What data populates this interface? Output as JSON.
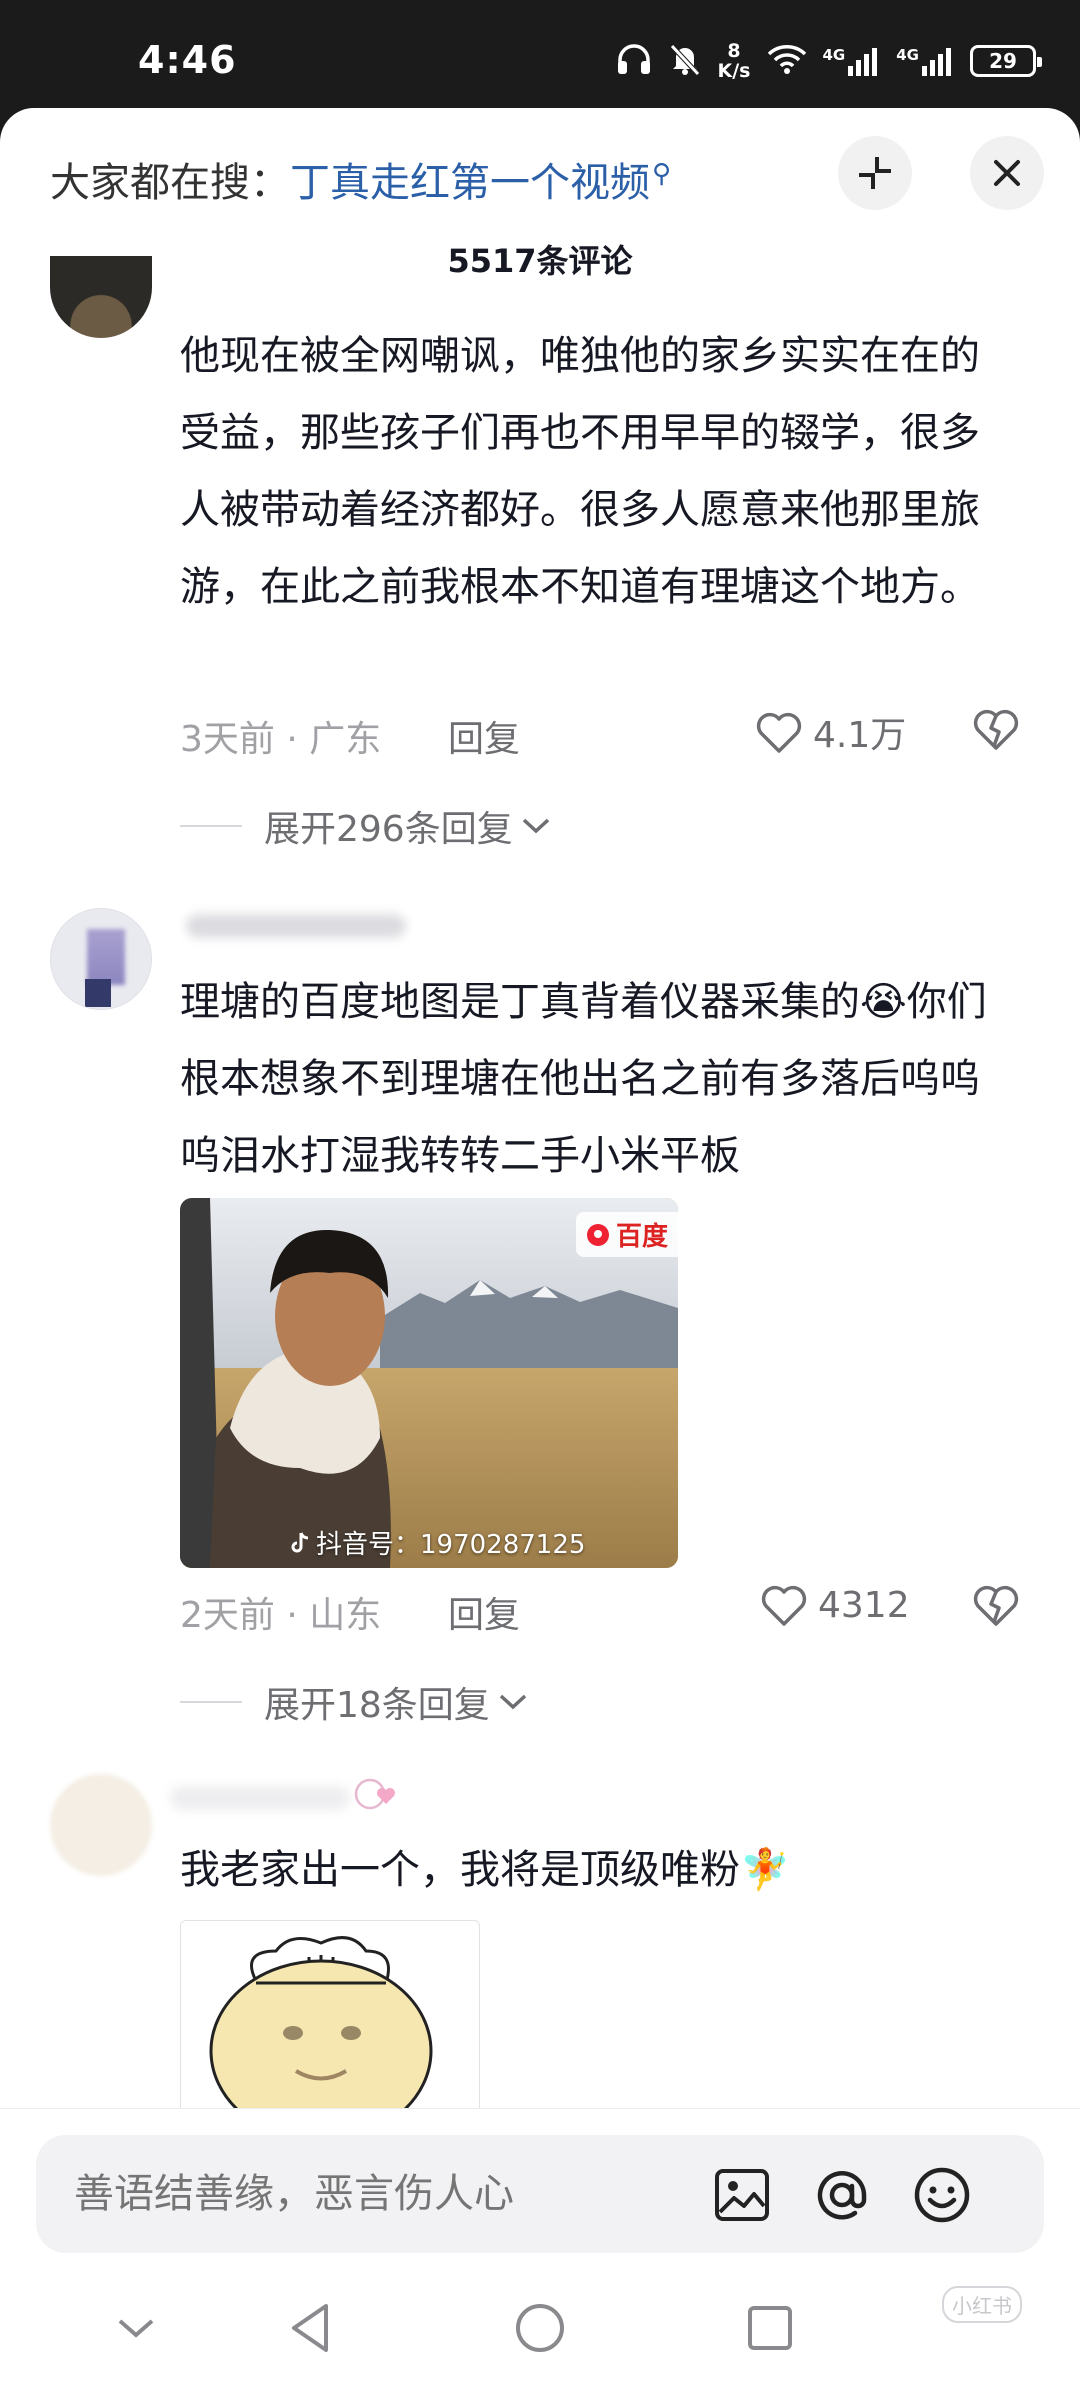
{
  "status_bar": {
    "time": "4:46",
    "speed_value": "8",
    "speed_unit": "K/s",
    "network_1": "4G",
    "network_2": "4G",
    "battery": "29"
  },
  "header": {
    "search_prefix": "大家都在搜：",
    "search_keyword": "丁真走红第一个视频",
    "comment_count": "5517条评论"
  },
  "comments": [
    {
      "text": "他现在被全网嘲讽，唯独他的家乡实实在在的受益，那些孩子们再也不用早早的辍学，很多人被带动着经济都好。很多人愿意来他那里旅游，在此之前我根本不知道有理塘这个地方。",
      "time_location": "3天前 · 广东",
      "reply_label": "回复",
      "likes": "4.1万",
      "expand_label": "展开296条回复"
    },
    {
      "text": "理塘的百度地图是丁真背着仪器采集的😭你们根本想象不到理塘在他出名之前有多落后呜呜呜泪水打湿我转转二手小米平板",
      "video_brand": "百度",
      "video_watermark": "抖音号：1970287125",
      "time_location": "2天前 · 山东",
      "reply_label": "回复",
      "likes": "4312",
      "expand_label": "展开18条回复"
    },
    {
      "text": "我老家出一个，我将是顶级唯粉🧚"
    }
  ],
  "input": {
    "placeholder": "善语结善缘，恶言伤人心"
  },
  "watermark": "小红书",
  "icons": [
    "headphones-icon",
    "mute-icon",
    "wifi-icon",
    "signal-icon",
    "battery-icon",
    "collapse-icon",
    "close-icon",
    "heart-icon",
    "broken-heart-icon",
    "chevron-down-icon",
    "image-icon",
    "at-icon",
    "emoji-icon",
    "back-icon",
    "home-icon",
    "recents-icon"
  ],
  "colors": {
    "keyword": "#2b5fa8",
    "meta": "#a0a0a5",
    "text": "#161823"
  }
}
